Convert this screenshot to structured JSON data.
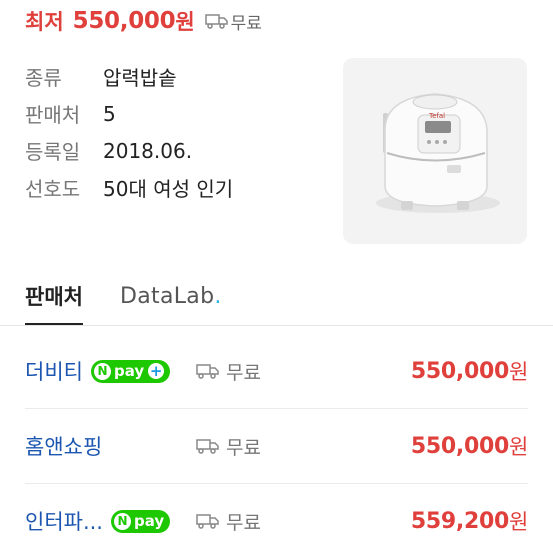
{
  "top": {
    "label": "최저",
    "price": "550,000",
    "currency": "원",
    "shipping": "무료",
    "accent_color": "#e0403c"
  },
  "spec": [
    {
      "key": "종류",
      "value": "압력밥솥"
    },
    {
      "key": "판매처",
      "value": "5"
    },
    {
      "key": "등록일",
      "value": "2018.06."
    },
    {
      "key": "선호도",
      "value": "50대 여성 인기"
    }
  ],
  "product_image": {
    "brand_text": "Tefal"
  },
  "tabs": [
    {
      "label": "판매처",
      "active": true
    },
    {
      "label": "DataLab",
      "dot": "."
    }
  ],
  "sellers": [
    {
      "name": "더비티",
      "badge": "Npay+",
      "shipping": "무료",
      "price": "550,000",
      "currency": "원"
    },
    {
      "name": "홈앤쇼핑",
      "badge": "",
      "shipping": "무료",
      "price": "550,000",
      "currency": "원"
    },
    {
      "name": "인터파...",
      "badge": "Npay",
      "shipping": "무료",
      "price": "559,200",
      "currency": "원"
    }
  ],
  "npay": {
    "n": "N",
    "text": "pay",
    "plus": "+"
  },
  "icons": {
    "shipping": "truck-icon"
  }
}
